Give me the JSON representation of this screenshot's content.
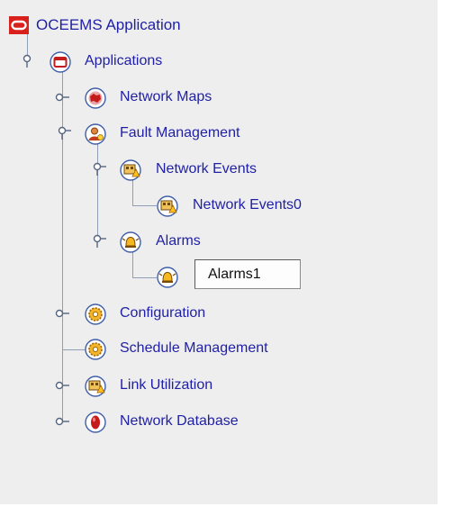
{
  "tree": {
    "root": {
      "label": "OCEEMS Application",
      "icon": "oracle-logo-icon"
    },
    "nodes": [
      {
        "id": "applications",
        "label": "Applications",
        "icon": "window-icon",
        "expanded": true
      },
      {
        "id": "network-maps",
        "label": "Network Maps",
        "icon": "map-icon",
        "expanded": false
      },
      {
        "id": "fault-management",
        "label": "Fault Management",
        "icon": "fault-user-icon",
        "expanded": true
      },
      {
        "id": "network-events",
        "label": "Network Events",
        "icon": "events-icon",
        "expanded": true
      },
      {
        "id": "network-events0",
        "label": "Network Events0",
        "icon": "events-icon"
      },
      {
        "id": "alarms",
        "label": "Alarms",
        "icon": "alarm-bell-icon",
        "expanded": true
      },
      {
        "id": "alarms1",
        "label": "Alarms1",
        "icon": "alarm-bell-icon",
        "editing": true
      },
      {
        "id": "configuration",
        "label": "Configuration",
        "icon": "gear-icon",
        "expanded": false
      },
      {
        "id": "schedule-management",
        "label": "Schedule Management",
        "icon": "gear-icon"
      },
      {
        "id": "link-utilization",
        "label": "Link Utilization",
        "icon": "events-icon",
        "expanded": false
      },
      {
        "id": "network-database",
        "label": "Network Database",
        "icon": "database-icon",
        "expanded": false
      }
    ]
  },
  "colors": {
    "label": "#1f1fa6",
    "oracle_red": "#d8201c",
    "connector": "#8e9fb5",
    "panel_bg": "#eeeeee"
  }
}
